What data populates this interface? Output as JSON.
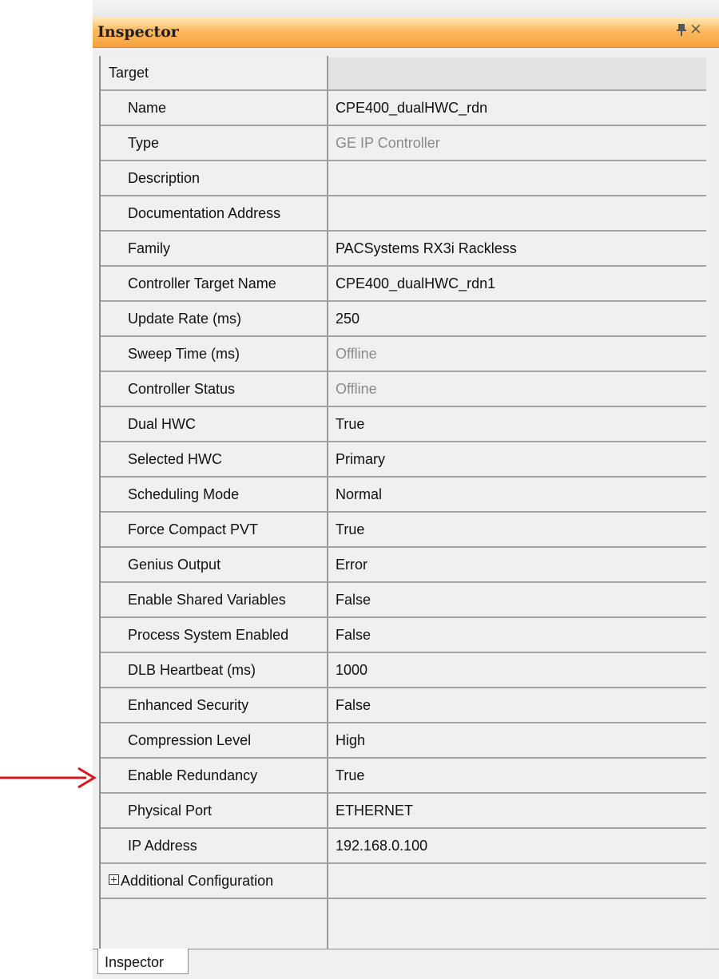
{
  "window": {
    "title": "Inspector"
  },
  "icons": {
    "pin": "pin-icon",
    "close": "close-icon",
    "expand": "plus-box-icon",
    "annotation": "red-arrow-icon"
  },
  "colors": {
    "title_bar": "#f5a13d",
    "annotation_arrow": "#e0121a"
  },
  "properties": [
    {
      "name": "Target",
      "value": ""
    },
    {
      "name": "Name",
      "value": "CPE400_dualHWC_rdn"
    },
    {
      "name": "Type",
      "value": "GE IP Controller"
    },
    {
      "name": "Description",
      "value": ""
    },
    {
      "name": "Documentation Address",
      "value": ""
    },
    {
      "name": "Family",
      "value": "PACSystems RX3i Rackless"
    },
    {
      "name": "Controller Target Name",
      "value": "CPE400_dualHWC_rdn1"
    },
    {
      "name": "Update Rate (ms)",
      "value": "250"
    },
    {
      "name": "Sweep Time (ms)",
      "value": "Offline"
    },
    {
      "name": "Controller Status",
      "value": "Offline"
    },
    {
      "name": "Dual HWC",
      "value": "True"
    },
    {
      "name": "Selected HWC",
      "value": "Primary"
    },
    {
      "name": "Scheduling Mode",
      "value": "Normal"
    },
    {
      "name": "Force Compact PVT",
      "value": "True"
    },
    {
      "name": "Genius Output",
      "value": "Error"
    },
    {
      "name": "Enable Shared Variables",
      "value": "False"
    },
    {
      "name": "Process System Enabled",
      "value": "False"
    },
    {
      "name": "DLB Heartbeat (ms)",
      "value": "1000"
    },
    {
      "name": "Enhanced Security",
      "value": "False"
    },
    {
      "name": "Compression Level",
      "value": "High"
    },
    {
      "name": "Enable Redundancy",
      "value": "True"
    },
    {
      "name": "Physical Port",
      "value": "ETHERNET"
    },
    {
      "name": "IP Address",
      "value": "192.168.0.100"
    },
    {
      "name": "Additional Configuration",
      "value": ""
    }
  ],
  "bottom_tab": {
    "label": "Inspector"
  }
}
